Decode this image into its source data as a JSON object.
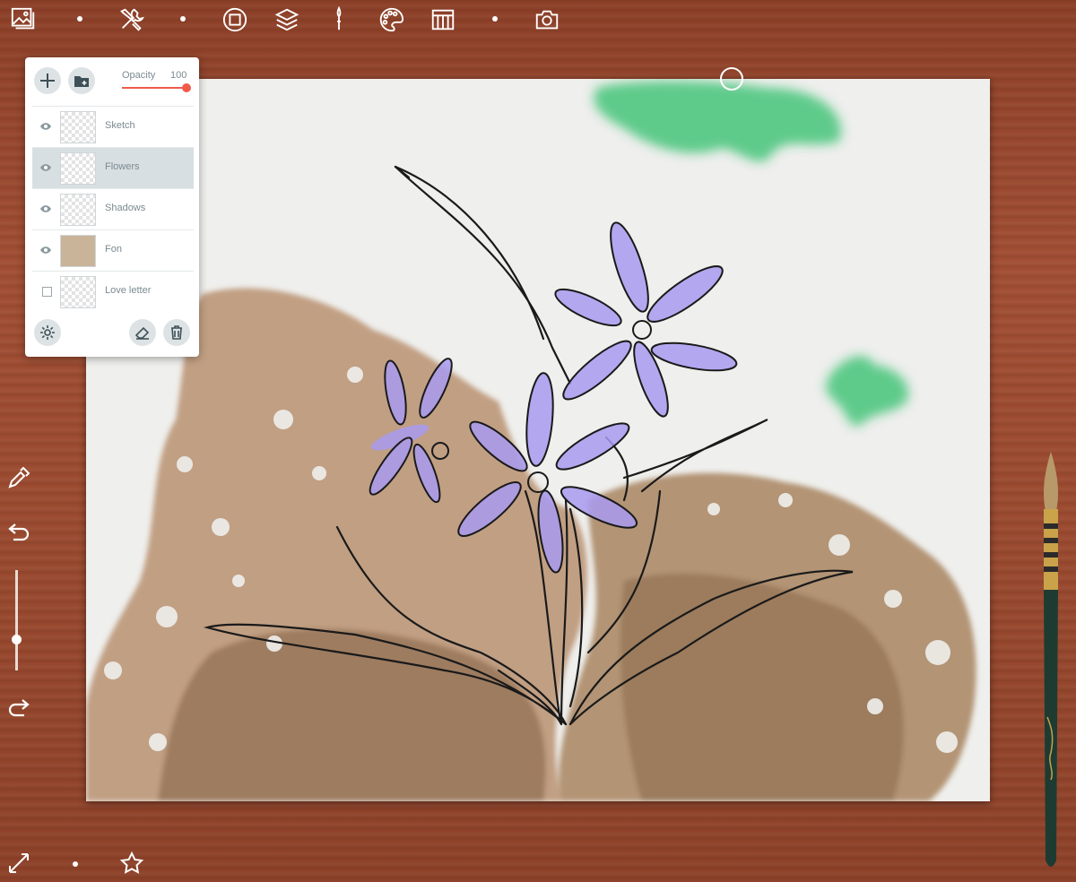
{
  "toolbar": {
    "buttons": [
      {
        "name": "gallery-icon"
      },
      {
        "name": "tools-icon"
      },
      {
        "name": "canvas-icon"
      },
      {
        "name": "layers-icon"
      },
      {
        "name": "brush-icon"
      },
      {
        "name": "palette-icon"
      },
      {
        "name": "paper-icon"
      },
      {
        "name": "camera-icon"
      }
    ]
  },
  "layers_panel": {
    "opacity_label": "Opacity",
    "opacity_value": "100",
    "opacity_level": 1.0,
    "accent_color": "#f05a4a",
    "layers": [
      {
        "name": "Sketch",
        "visible": true,
        "selected": false
      },
      {
        "name": "Flowers",
        "visible": true,
        "selected": true
      },
      {
        "name": "Shadows",
        "visible": true,
        "selected": false
      },
      {
        "name": "Fon",
        "visible": true,
        "selected": false
      },
      {
        "name": "Love letter",
        "visible": false,
        "selected": false
      }
    ],
    "buttons": [
      "add-layer-icon",
      "add-folder-icon",
      "settings-icon",
      "eraser-icon",
      "trash-icon"
    ]
  },
  "side_tools": [
    "eyedropper-icon",
    "undo-icon",
    "brush-size-slider",
    "redo-icon"
  ],
  "bottom_tools": [
    "fullscreen-icon",
    "favorite-star-icon"
  ],
  "colors": {
    "wood": "#9a4a2f",
    "paper": "#efefed",
    "brown_paint": "#a8845f",
    "violet_paint": "#a89af0",
    "green_paint": "#2fbf6a"
  }
}
